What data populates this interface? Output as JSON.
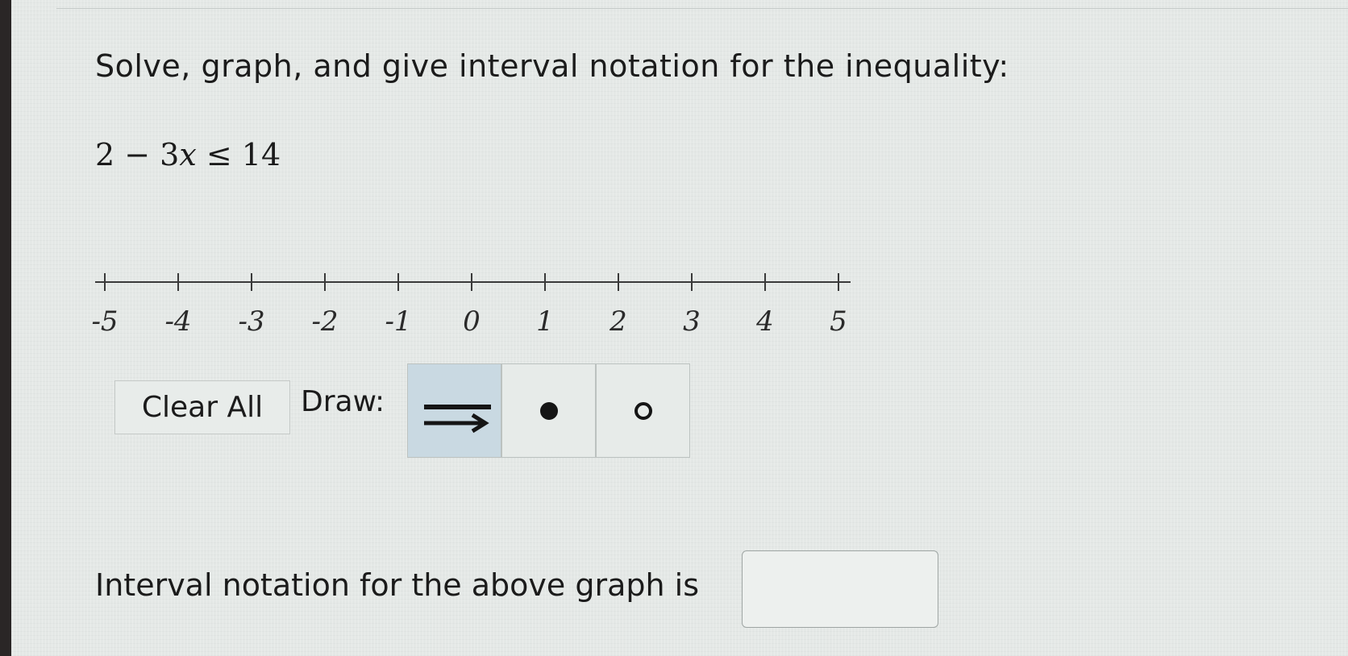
{
  "question": {
    "prompt": "Solve, graph, and give interval notation for the inequality:",
    "equation": {
      "left": "2 − 3",
      "variable": "x",
      "right": " ≤ 14"
    }
  },
  "number_line": {
    "min": -5,
    "max": 5,
    "tick_labels": [
      "-5",
      "-4",
      "-3",
      "-2",
      "-1",
      "0",
      "1",
      "2",
      "3",
      "4",
      "5"
    ]
  },
  "toolbar": {
    "clear_label": "Clear All",
    "draw_label": "Draw:",
    "tools": [
      {
        "icon": "ray-arrow-icon",
        "active": true
      },
      {
        "icon": "closed-dot-icon",
        "active": false
      },
      {
        "icon": "open-dot-icon",
        "active": false
      }
    ]
  },
  "answer": {
    "label": "Interval notation for the above graph is",
    "value": ""
  },
  "colors": {
    "background": "#e4e8e6",
    "active_tool": "#c9d9e2",
    "line": "#3a3a3a"
  }
}
